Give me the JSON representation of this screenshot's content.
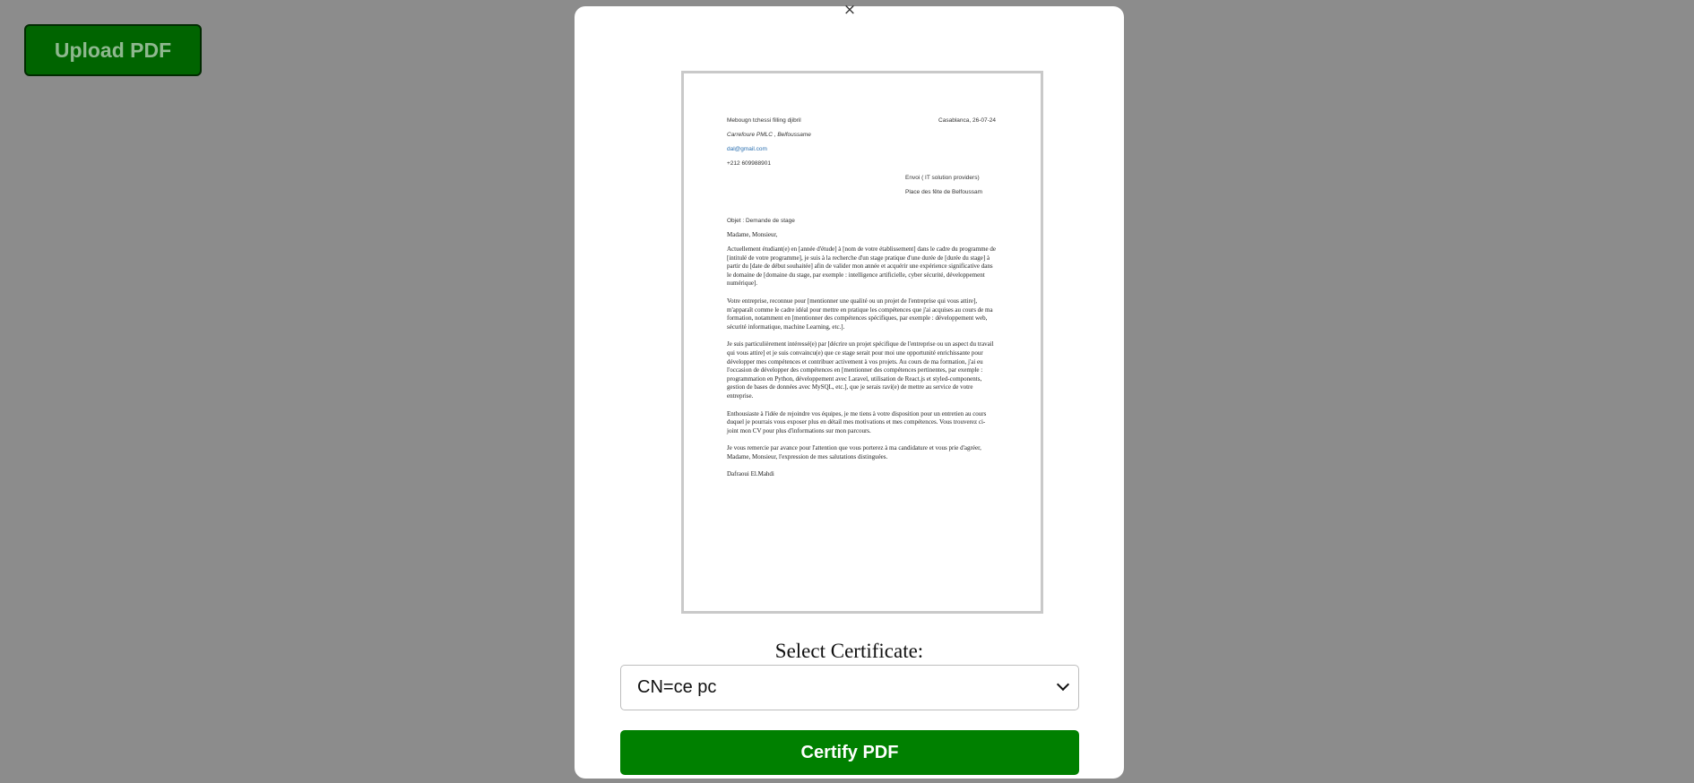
{
  "upload_button": {
    "label": "Upload PDF"
  },
  "modal": {
    "close_glyph": "×",
    "certificate_label": "Select Certificate:",
    "certificate_selected": "CN=ce pc",
    "certify_button": "Certify PDF"
  },
  "document": {
    "sender_name": "Mebougn tchessi filling djibril",
    "date_place": "Casablanca, 26-07-24",
    "sender_address": "Carrefoure PMLC , Belfoussame",
    "sender_email": "dal@gmail.com",
    "sender_phone": "+212 609988901",
    "recipient_line1": "Envoi ( IT solution providers)",
    "recipient_line2": "Place des fête de Belfoussam",
    "subject": "Objet : Demande de stage",
    "greeting": "Madame, Monsieur,",
    "paragraphs": [
      "Actuellement étudiant(e) en [année d'étude] à [nom de votre établissement] dans le cadre du programme de [intitulé de votre programme], je suis à la recherche d'un stage pratique d'une durée de [durée du stage] à partir du [date de début souhaitée] afin de valider mon année et acquérir une expérience significative dans le domaine de [domaine du stage, par exemple : intelligence artificielle, cyber sécurité, développement numérique].",
      "Votre entreprise, reconnue pour [mentionner une qualité ou un projet de l'entreprise qui vous attire], m'apparaît comme le cadre idéal pour mettre en pratique les compétences que j'ai acquises au cours de ma formation, notamment en [mentionner des compétences spécifiques, par exemple : développement web, sécurité informatique, machine Learning, etc.].",
      "Je suis particulièrement intéressé(e) par [décrire un projet spécifique de l'entreprise ou un aspect du travail qui vous attire] et je suis convaincu(e) que ce stage serait pour moi une opportunité enrichissante pour développer mes compétences et contribuer activement à vos projets. Au cours de ma formation, j'ai eu l'occasion de développer des compétences en [mentionner des compétences pertinentes, par exemple : programmation en Python, développement avec Laravel, utilisation de React.js et styled-components, gestion de bases de données avec MySQL, etc.], que je serais ravi(e) de mettre au service de votre entreprise.",
      "Enthousiaste à l'idée de rejoindre vos équipes, je me tiens à votre disposition pour un entretien au cours duquel je pourrais vous exposer plus en détail mes motivations et mes compétences. Vous trouverez ci-joint mon CV pour plus d'informations sur mon parcours.",
      "Je vous remercie par avance pour l'attention que vous porterez à ma candidature et vous prie d'agréer, Madame, Monsieur, l'expression de mes salutations distinguées."
    ],
    "signature": "Dafraoui El.Mahdi"
  }
}
